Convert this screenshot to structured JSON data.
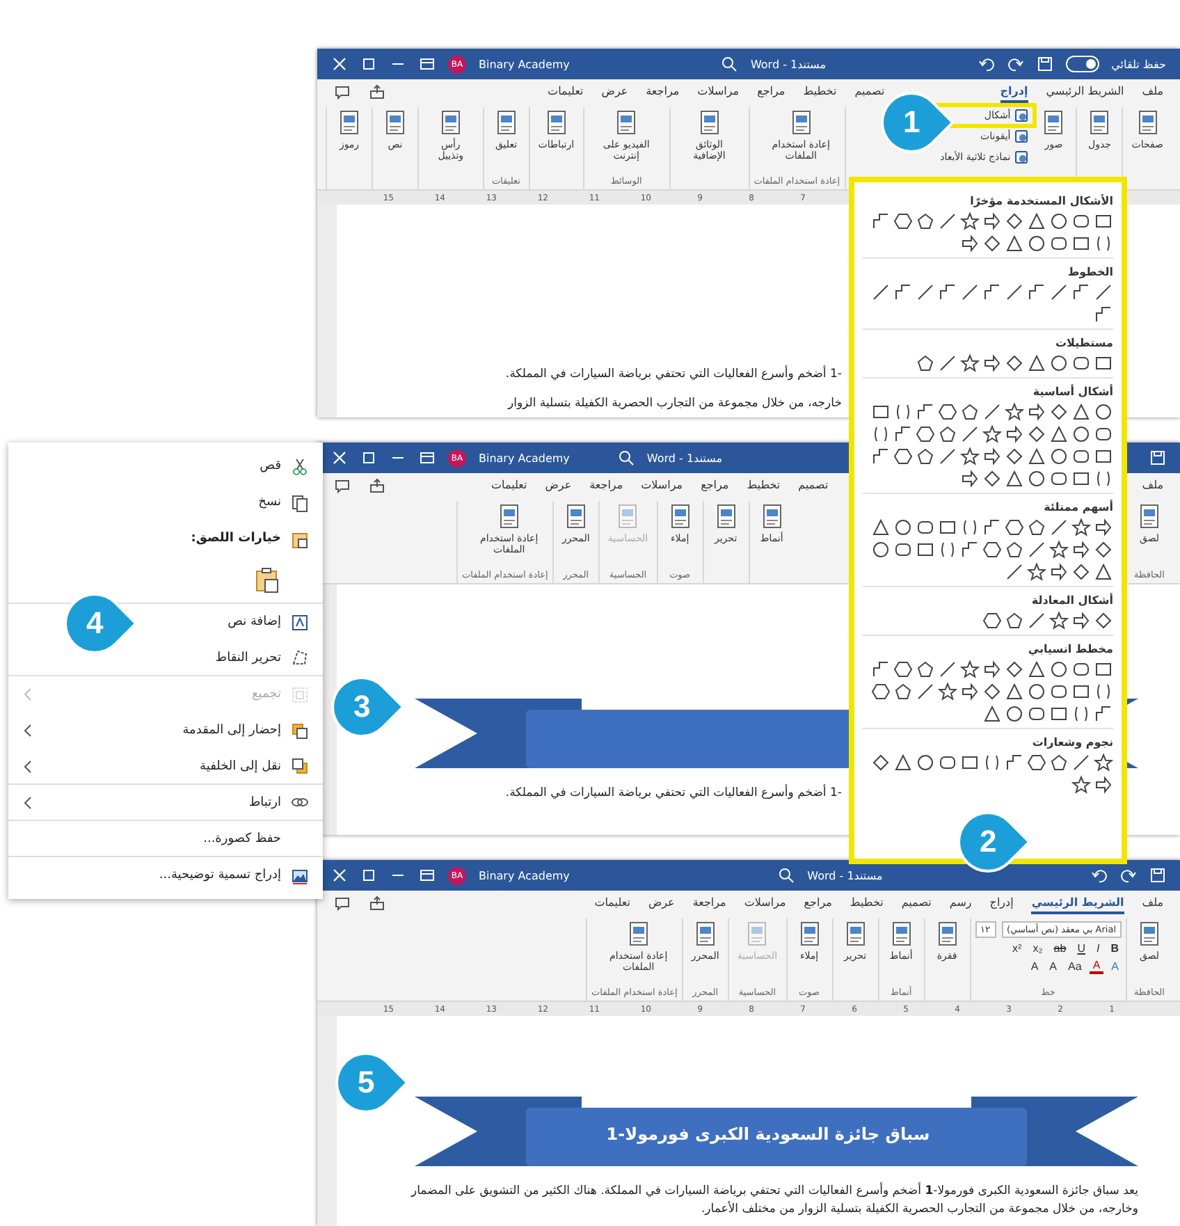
{
  "windows": [
    {
      "title_bar": {
        "autosave": "حفظ تلقائي",
        "autosave_on": false,
        "document": "مستند1 - Word",
        "user": "Binary Academy",
        "initials": "BA"
      },
      "tabs": [
        {
          "label": "ملف",
          "selected": false
        },
        {
          "label": "الشريط الرئيسي",
          "selected": false
        },
        {
          "label": "إدراج",
          "selected": true
        },
        {
          "label": "تصميم",
          "selected": false
        },
        {
          "label": "تخطيط",
          "selected": false
        },
        {
          "label": "مراجع",
          "selected": false
        },
        {
          "label": "مراسلات",
          "selected": false
        },
        {
          "label": "مراجعة",
          "selected": false
        },
        {
          "label": "عرض",
          "selected": false
        },
        {
          "label": "تعليمات",
          "selected": false
        }
      ],
      "ribbon": [
        {
          "buttons": [
            {
              "label": "صفحات",
              "kind": "large",
              "highlighted": false,
              "disabled": false
            }
          ]
        },
        {
          "buttons": [
            {
              "label": "جدول",
              "kind": "large",
              "highlighted": false,
              "disabled": false
            }
          ]
        },
        {
          "buttons": [
            {
              "label": "صور",
              "kind": "large",
              "highlighted": false,
              "disabled": false
            },
            {
              "label": "أشكال",
              "kind": "small",
              "highlighted": true,
              "disabled": false
            },
            {
              "label": "أيقونات",
              "kind": "small",
              "highlighted": false,
              "disabled": false
            },
            {
              "label": "نماذج ثلاثية الأبعاد",
              "kind": "small",
              "highlighted": false,
              "disabled": false
            }
          ]
        },
        {
          "label": "إعادة استخدام الملفات",
          "buttons": [
            {
              "label": "إعادة استخدام الملفات",
              "kind": "large",
              "highlighted": false,
              "disabled": false
            }
          ]
        },
        {
          "buttons": [
            {
              "label": "الوثائق الإضافية",
              "kind": "large",
              "highlighted": false,
              "disabled": false
            }
          ]
        },
        {
          "label": "الوسائط",
          "buttons": [
            {
              "label": "الفيديو على إنترنت",
              "kind": "large",
              "highlighted": false,
              "disabled": false
            }
          ]
        },
        {
          "buttons": [
            {
              "label": "ارتباطات",
              "kind": "large",
              "highlighted": false,
              "disabled": false
            }
          ]
        },
        {
          "label": "تعليقات",
          "buttons": [
            {
              "label": "تعليق",
              "kind": "large",
              "highlighted": false,
              "disabled": false
            }
          ]
        },
        {
          "buttons": [
            {
              "label": "رأس وتذييل",
              "kind": "large",
              "highlighted": false,
              "disabled": false
            }
          ]
        },
        {
          "buttons": [
            {
              "label": "نص",
              "kind": "large",
              "highlighted": false,
              "disabled": false
            }
          ]
        },
        {
          "buttons": [
            {
              "label": "رموز",
              "kind": "large",
              "highlighted": false,
              "disabled": false
            }
          ]
        }
      ],
      "ruler": [
        "7",
        "8",
        "9",
        "10",
        "11",
        "12",
        "13",
        "14",
        "15"
      ],
      "document": [
        {
          "kind": "paragraph",
          "text": "-1 أضخم وأسرع الفعاليات التي تحتفي برياضة السيارات في المملكة."
        },
        {
          "kind": "paragraph",
          "text": "خارجه، من خلال مجموعة من التجارب الحصرية الكفيلة بتسلية الزوار"
        }
      ]
    },
    {
      "title_bar": {
        "document": "مستند1 - Word",
        "user": "Binary Academy",
        "initials": "BA"
      },
      "tabs": [
        {
          "label": "ملف",
          "selected": false
        },
        {
          "label": "تصميم",
          "selected": false
        },
        {
          "label": "تخطيط",
          "selected": false
        },
        {
          "label": "مراجع",
          "selected": false
        },
        {
          "label": "مراسلات",
          "selected": false
        },
        {
          "label": "مراجعة",
          "selected": false
        },
        {
          "label": "عرض",
          "selected": false
        },
        {
          "label": "تعليمات",
          "selected": false
        }
      ],
      "ribbon": [
        {
          "label": "الحافظة",
          "buttons": [
            {
              "label": "لصق",
              "kind": "large",
              "highlighted": false,
              "disabled": false
            }
          ]
        },
        {
          "buttons": [
            {
              "label": "أنماط",
              "kind": "large",
              "highlighted": false,
              "disabled": false
            }
          ]
        },
        {
          "buttons": [
            {
              "label": "تحرير",
              "kind": "large",
              "highlighted": false,
              "disabled": false
            }
          ]
        },
        {
          "label": "صوت",
          "buttons": [
            {
              "label": "إملاء",
              "kind": "large",
              "highlighted": false,
              "disabled": false
            }
          ]
        },
        {
          "label": "الحساسية",
          "buttons": [
            {
              "label": "الحساسية",
              "kind": "large",
              "highlighted": false,
              "disabled": true
            }
          ]
        },
        {
          "label": "المحرر",
          "buttons": [
            {
              "label": "المحرر",
              "kind": "large",
              "highlighted": false,
              "disabled": false
            }
          ]
        },
        {
          "label": "إعادة استخدام الملفات",
          "buttons": [
            {
              "label": "إعادة استخدام الملفات",
              "kind": "large",
              "highlighted": false,
              "disabled": false
            }
          ]
        }
      ],
      "document": [
        {
          "kind": "banner"
        },
        {
          "kind": "paragraph",
          "text": "-1 أضخم وأسرع الفعاليات التي تحتفي برياضة السيارات في المملكة."
        }
      ]
    },
    {
      "title_bar": {
        "document": "مستند1 - Word",
        "user": "Binary Academy",
        "initials": "BA"
      },
      "tabs": [
        {
          "label": "ملف",
          "selected": false
        },
        {
          "label": "الشريط الرئيسي",
          "selected": true
        },
        {
          "label": "إدراج",
          "selected": false
        },
        {
          "label": "رسم",
          "selected": false
        },
        {
          "label": "تصميم",
          "selected": false
        },
        {
          "label": "تخطيط",
          "selected": false
        },
        {
          "label": "مراجع",
          "selected": false
        },
        {
          "label": "مراسلات",
          "selected": false
        },
        {
          "label": "مراجعة",
          "selected": false
        },
        {
          "label": "عرض",
          "selected": false
        },
        {
          "label": "تعليمات",
          "selected": false
        }
      ],
      "ribbon": [
        {
          "label": "الحافظة",
          "buttons": [
            {
              "label": "لصق",
              "kind": "large",
              "highlighted": false,
              "disabled": false
            }
          ]
        },
        {
          "label": "خط",
          "kind": "font",
          "font_name": "بي معقد (نص أساسي) Arial",
          "font_size": "١٢",
          "row1": [
            "B",
            "I",
            "U",
            "ab",
            "x₂",
            "x²"
          ],
          "row2": [
            "A",
            "A",
            "Aa",
            "A",
            "A"
          ]
        },
        {
          "buttons": [
            {
              "label": "فقرة",
              "kind": "large",
              "highlighted": false,
              "disabled": false
            }
          ]
        },
        {
          "label": "أنماط",
          "buttons": [
            {
              "label": "أنماط",
              "kind": "large",
              "highlighted": false,
              "disabled": false
            }
          ]
        },
        {
          "buttons": [
            {
              "label": "تحرير",
              "kind": "large",
              "highlighted": false,
              "disabled": false
            }
          ]
        },
        {
          "label": "صوت",
          "buttons": [
            {
              "label": "إملاء",
              "kind": "large",
              "highlighted": false,
              "disabled": false
            }
          ]
        },
        {
          "label": "الحساسية",
          "buttons": [
            {
              "label": "الحساسية",
              "kind": "large",
              "highlighted": false,
              "disabled": true
            }
          ]
        },
        {
          "label": "المحرر",
          "buttons": [
            {
              "label": "المحرر",
              "kind": "large",
              "highlighted": false,
              "disabled": false
            }
          ]
        },
        {
          "label": "إعادة استخدام الملفات",
          "buttons": [
            {
              "label": "إعادة استخدام الملفات",
              "kind": "large",
              "highlighted": false,
              "disabled": false
            }
          ]
        }
      ],
      "ruler": [
        "1",
        "2",
        "3",
        "4",
        "5",
        "6",
        "7",
        "8",
        "9",
        "10",
        "11",
        "12",
        "13",
        "14",
        "15"
      ],
      "document": [
        {
          "kind": "banner",
          "title": "سباق جائزة السعودية الكبرى فورمولا-1"
        },
        {
          "kind": "paragraph",
          "text": "يعد سباق جائزة السعودية الكبرى فورمولا-**1** أضخم وأسرع الفعاليات التي تحتفي برياضة السيارات في المملكة. هناك الكثير من التشويق على المضمار وخارجه، من خلال مجموعة من التجارب الحصرية الكفيلة بتسلية الزوار من مختلف الأعمار."
        }
      ]
    }
  ],
  "shapes_menu": {
    "sections": [
      {
        "heading": "الأشكال المستخدمة مؤخرًا"
      },
      {
        "heading": "الخطوط"
      },
      {
        "heading": "مستطيلات"
      },
      {
        "heading": "أشكال أساسية"
      },
      {
        "heading": "أسهم ممتلئة"
      },
      {
        "heading": "أشكال المعادلة"
      },
      {
        "heading": "مخطط انسيابي"
      },
      {
        "heading": "نجوم وشعارات"
      }
    ]
  },
  "context_menu": [
    {
      "label": "قص",
      "kind": "command",
      "disabled": false,
      "divider": false
    },
    {
      "label": "نسخ",
      "kind": "command",
      "disabled": false,
      "divider": false
    },
    {
      "label": "خيارات اللصق:",
      "kind": "heading",
      "disabled": false,
      "divider": false
    },
    {
      "kind": "paste_options",
      "disabled": false,
      "divider": true
    },
    {
      "label": "إضافة نص",
      "kind": "command",
      "disabled": false,
      "divider": false
    },
    {
      "label": "تحرير النقاط",
      "kind": "command",
      "disabled": false,
      "divider": true
    },
    {
      "label": "تجميع",
      "kind": "submenu",
      "disabled": true,
      "divider": false
    },
    {
      "label": "إحضار إلى المقدمة",
      "kind": "submenu",
      "disabled": false,
      "divider": false
    },
    {
      "label": "نقل إلى الخلفية",
      "kind": "submenu",
      "disabled": false,
      "divider": true
    },
    {
      "label": "ارتباط",
      "kind": "submenu",
      "disabled": false,
      "divider": true
    },
    {
      "label": "حفظ كصورة...",
      "kind": "command",
      "disabled": false,
      "divider": true
    },
    {
      "label": "إدراج تسمية توضيحية...",
      "kind": "command",
      "disabled": false,
      "divider": false
    }
  ],
  "callouts": [
    "1",
    "2",
    "3",
    "4",
    "5"
  ]
}
